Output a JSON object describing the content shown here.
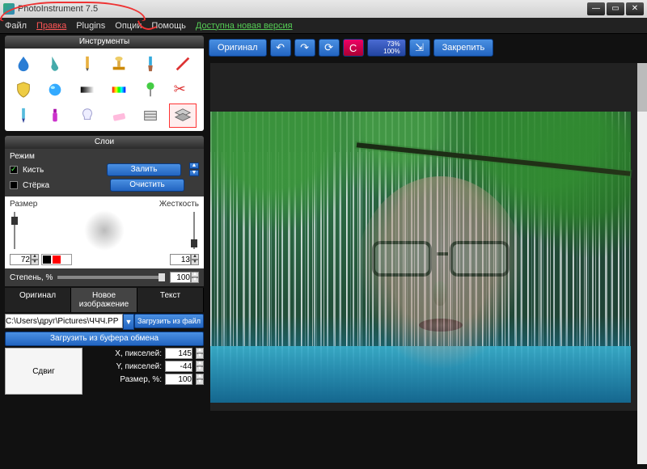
{
  "app": {
    "title": "PhotoInstrument 7.5"
  },
  "menu": {
    "file": "Файл",
    "edit": "Правка",
    "plugins": "Plugins",
    "options": "Опции",
    "help": "Помощь",
    "update": "Доступна новая версия"
  },
  "toolbar": {
    "original": "Оригинал",
    "undo_icon": "↶",
    "redo_icon": "↷",
    "rotate_icon": "⟳",
    "reset_icon": "C",
    "zoom_pct": "73%",
    "zoom_full": "100%",
    "zoom_icon": "⇲",
    "pin": "Закрепить"
  },
  "panels": {
    "tools_title": "Инструменты",
    "layers_title": "Слои"
  },
  "mode": {
    "label": "Режим",
    "brush": "Кисть",
    "eraser": "Стёрка",
    "fill": "Залить",
    "clear": "Очистить"
  },
  "brush": {
    "size_label": "Размер",
    "hardness_label": "Жесткость",
    "size_value": "72",
    "hardness_value": "13"
  },
  "opacity": {
    "label": "Степень, %",
    "value": "100"
  },
  "tabs": {
    "original": "Оригинал",
    "new_image": "Новое изображение",
    "text": "Текст"
  },
  "file": {
    "path": "C:\\Users\\друг\\Pictures\\ЧЧЧ.PР",
    "load_file": "Загрузить из файл",
    "load_clipboard": "Загрузить из буфера обмена"
  },
  "shift": {
    "btn": "Сдвиг",
    "x_label": "X, пикселей:",
    "y_label": "Y, пикселей:",
    "scale_label": "Размер, %:",
    "x": "145",
    "y": "-44",
    "scale": "100"
  },
  "colors": {
    "black": "#000000",
    "red": "#ff0000",
    "white": "#ffffff"
  }
}
